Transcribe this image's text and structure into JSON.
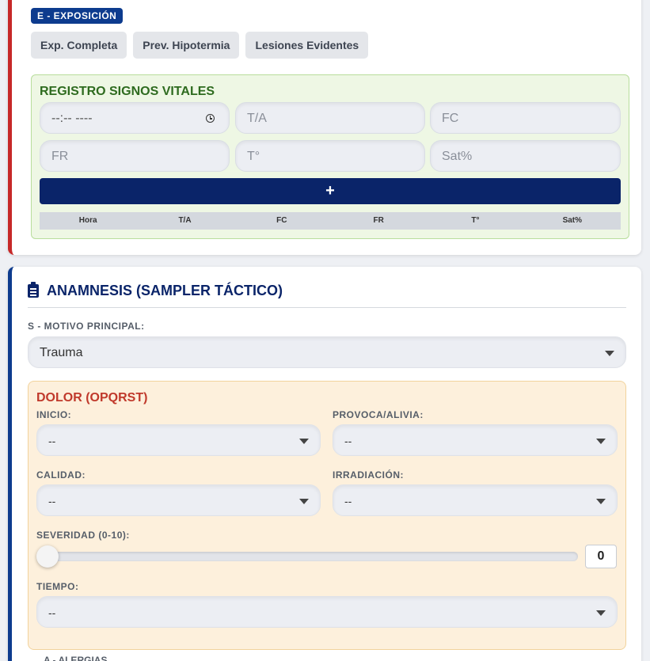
{
  "exposure": {
    "badge": "E - EXPOSICIÓN",
    "chips": [
      "Exp. Completa",
      "Prev. Hipotermia",
      "Lesiones Evidentes"
    ]
  },
  "vitals": {
    "title": "REGISTRO SIGNOS VITALES",
    "time_placeholder": "--:-- ----",
    "ta_placeholder": "T/A",
    "fc_placeholder": "FC",
    "fr_placeholder": "FR",
    "temp_placeholder": "T°",
    "sat_placeholder": "Sat%",
    "add_label": "+",
    "table_headers": [
      "Hora",
      "T/A",
      "FC",
      "FR",
      "T°",
      "Sat%"
    ]
  },
  "anamnesis": {
    "title": "ANAMNESIS (SAMPLER TÁCTICO)",
    "motivo_label": "S - MOTIVO PRINCIPAL:",
    "motivo_value": "Trauma",
    "pain": {
      "title": "DOLOR (OPQRST)",
      "inicio_label": "INICIO:",
      "inicio_value": "--",
      "provoca_label": "PROVOCA/ALIVIA:",
      "provoca_value": "--",
      "calidad_label": "CALIDAD:",
      "calidad_value": "--",
      "irradiacion_label": "IRRADIACIÓN:",
      "irradiacion_value": "--",
      "severidad_label": "SEVERIDAD (0-10):",
      "severidad_value": "0",
      "tiempo_label": "TIEMPO:",
      "tiempo_value": "--"
    },
    "alergias_label": "A - ALERGIAS"
  }
}
